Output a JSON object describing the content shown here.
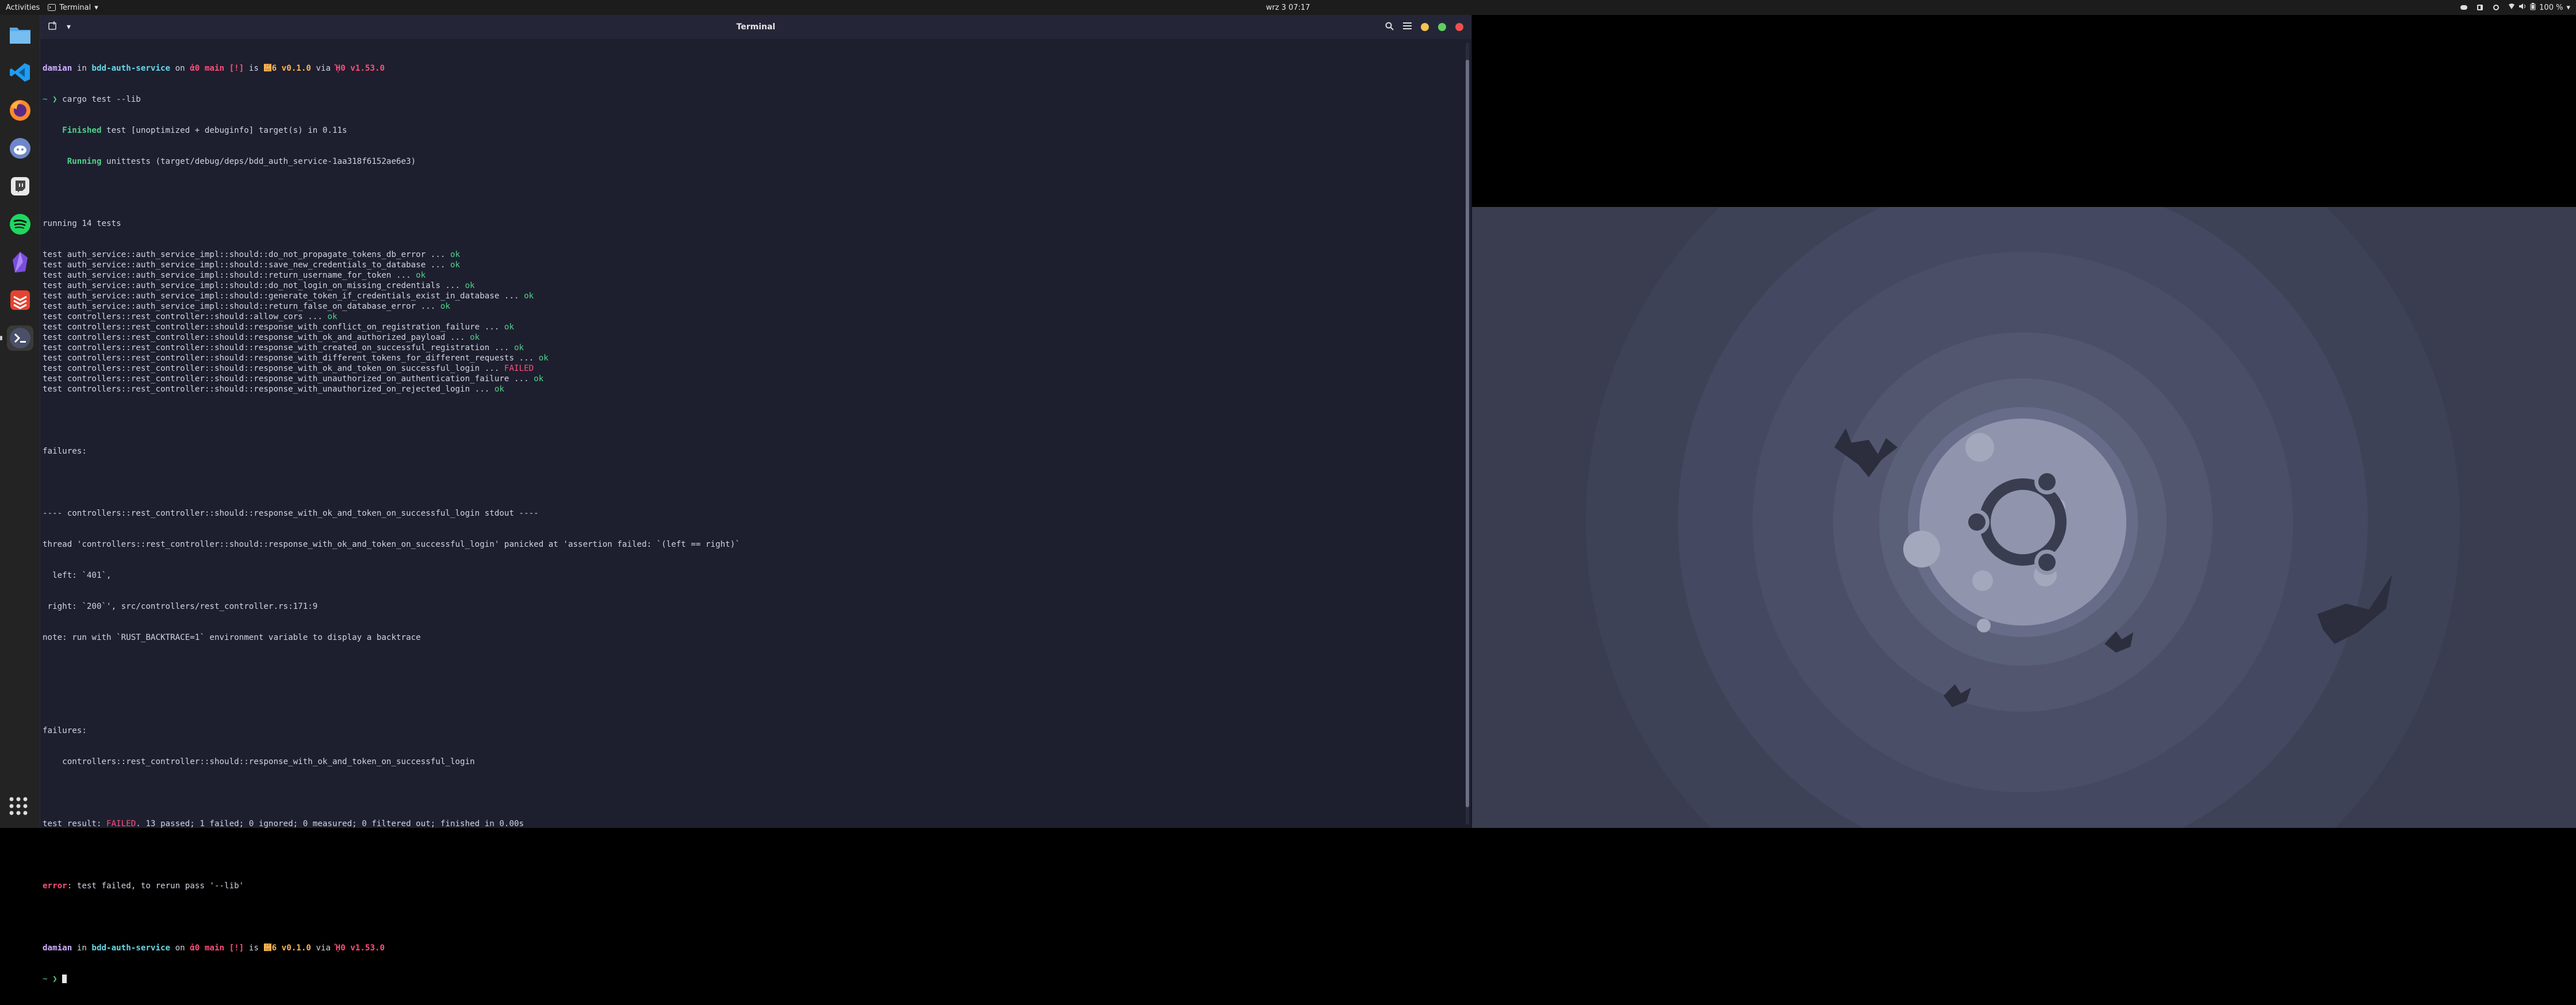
{
  "topbar": {
    "activities": "Activities",
    "app_menu": "Terminal",
    "clock": "wrz 3  07:17",
    "battery": "100 %"
  },
  "dock": {
    "apps": [
      "files",
      "vscode",
      "firefox",
      "reddit",
      "twitch",
      "spotify",
      "obsidian",
      "todoist",
      "terminal"
    ],
    "show_apps_icon": "grid-icon"
  },
  "terminal": {
    "title": "Terminal",
    "lines": {
      "p1_user": "damian",
      "p1_in": " in ",
      "p1_dir": "bdd-auth-service",
      "p1_on": " on ",
      "p1_branch": "ἀ0 main [!]",
      "p1_is": " is ",
      "p1_ver": "὎6 v0.1.0",
      "p1_via": " via ",
      "p1_rust": "ᾘ0 v1.53.0",
      "cmd1": " cargo test --lib",
      "finished_kw": "    Finished",
      "finished_rest": " test [unoptimized + debuginfo] target(s) in 0.11s",
      "running_kw": "     Running",
      "running_rest": " unittests (target/debug/deps/bdd_auth_service-1aa318f6152ae6e3)",
      "running_tests": "running 14 tests",
      "tests": [
        {
          "text": "test auth_service::auth_service_impl::should::do_not_propagate_tokens_db_error ... ",
          "status": "ok"
        },
        {
          "text": "test auth_service::auth_service_impl::should::save_new_credentials_to_database ... ",
          "status": "ok"
        },
        {
          "text": "test auth_service::auth_service_impl::should::return_username_for_token ... ",
          "status": "ok"
        },
        {
          "text": "test auth_service::auth_service_impl::should::do_not_login_on_missing_credentials ... ",
          "status": "ok"
        },
        {
          "text": "test auth_service::auth_service_impl::should::generate_token_if_credentials_exist_in_database ... ",
          "status": "ok"
        },
        {
          "text": "test auth_service::auth_service_impl::should::return_false_on_database_error ... ",
          "status": "ok"
        },
        {
          "text": "test controllers::rest_controller::should::allow_cors ... ",
          "status": "ok"
        },
        {
          "text": "test controllers::rest_controller::should::response_with_conflict_on_registration_failure ... ",
          "status": "ok"
        },
        {
          "text": "test controllers::rest_controller::should::response_with_ok_and_authorized_payload ... ",
          "status": "ok"
        },
        {
          "text": "test controllers::rest_controller::should::response_with_created_on_successful_registration ... ",
          "status": "ok"
        },
        {
          "text": "test controllers::rest_controller::should::response_with_different_tokens_for_different_requests ... ",
          "status": "ok"
        },
        {
          "text": "test controllers::rest_controller::should::response_with_ok_and_token_on_successful_login ... ",
          "status": "FAILED"
        },
        {
          "text": "test controllers::rest_controller::should::response_with_unauthorized_on_authentication_failure ... ",
          "status": "ok"
        },
        {
          "text": "test controllers::rest_controller::should::response_with_unauthorized_on_rejected_login ... ",
          "status": "ok"
        }
      ],
      "failures1": "failures:",
      "stdout_header": "---- controllers::rest_controller::should::response_with_ok_and_token_on_successful_login stdout ----",
      "panic": "thread 'controllers::rest_controller::should::response_with_ok_and_token_on_successful_login' panicked at 'assertion failed: `(left == right)`",
      "left": "  left: `401`,",
      "right": " right: `200`', src/controllers/rest_controller.rs:171:9",
      "note": "note: run with `RUST_BACKTRACE=1` environment variable to display a backtrace",
      "failures2": "failures:",
      "failed_test": "    controllers::rest_controller::should::response_with_ok_and_token_on_successful_login",
      "result_prefix": "test result: ",
      "result_failed": "FAILED",
      "result_rest": ". 13 passed; 1 failed; 0 ignored; 0 measured; 0 filtered out; finished in 0.00s",
      "error_kw": "error",
      "error_rest": ": test failed, to rerun pass '--lib'",
      "prompt_arrow": "~ ❯"
    }
  },
  "colors": {
    "terminal_bg": "#1d1f2e",
    "ok": "#4ed28a",
    "failed": "#ff4f79",
    "wallpaper": "#3a3d50"
  }
}
